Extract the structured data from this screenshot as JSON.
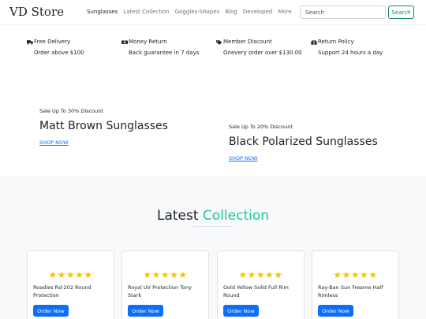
{
  "header": {
    "brand": "VD Store",
    "nav": [
      "Sunglasses",
      "Latest Collection",
      "Goggles-Shapes",
      "Blog",
      "Developed",
      "More"
    ],
    "search_placeholder": "Search",
    "search_button": "Search"
  },
  "features": [
    {
      "title": "Free Delivery",
      "subtitle": "Order above $100",
      "icon": "truck-icon"
    },
    {
      "title": "Money Return",
      "subtitle": "Back guarantee in 7 days",
      "icon": "money-icon"
    },
    {
      "title": "Member Discount",
      "subtitle": "Onevery order over $130.00",
      "icon": "tag-icon"
    },
    {
      "title": "Return Policy",
      "subtitle": "Support 24 hours a day",
      "icon": "gift-icon"
    }
  ],
  "promos": [
    {
      "pre": "Sale Up To 30% Discount",
      "title": "Matt Brown Sunglasses",
      "link": "SHOP NOW"
    },
    {
      "pre": "Sale Up To 20% Discount",
      "title": "Black Polarized Sunglasses",
      "link": "SHOP NOW"
    }
  ],
  "latest": {
    "title_main": "Latest ",
    "title_accent": "Collection",
    "accent_color": "#20c997"
  },
  "products": [
    {
      "name": "Roadies Rd-202 Round Protection",
      "rating": 5,
      "button": "Order Now"
    },
    {
      "name": "Royal UV Protection Tony Stark",
      "rating": 5,
      "button": "Order Now"
    },
    {
      "name": "Gold Yellow Solid Full Rim Round",
      "rating": 5,
      "button": "Order Now"
    },
    {
      "name": "Ray-Ban Sun Freame Half Rimless",
      "rating": 5,
      "button": "Order Now"
    }
  ],
  "colors": {
    "primary": "#0d6efd",
    "success": "#198754",
    "star": "#f2c30f"
  }
}
